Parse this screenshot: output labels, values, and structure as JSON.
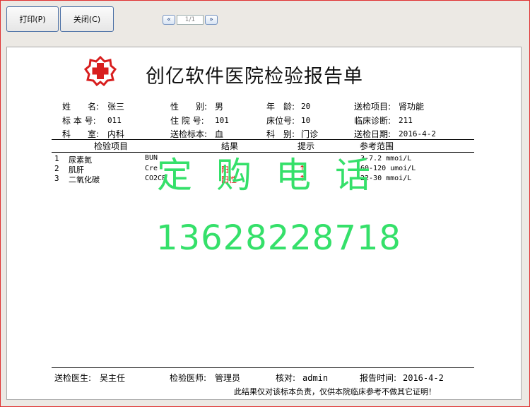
{
  "toolbar": {
    "print_label": "打印(P)",
    "close_label": "关闭(C)",
    "prev_glyph": "«",
    "next_glyph": "»",
    "page_indicator": "1/1"
  },
  "report": {
    "title": "创亿软件医院检验报告单",
    "fields": {
      "name_label": "姓　　名:",
      "name": "张三",
      "gender_label": "性　　别:",
      "gender": "男",
      "age_label": "年　龄:",
      "age": "20",
      "item_label": "送检项目:",
      "item": "肾功能",
      "specimen_no_label": "标 本 号:",
      "specimen_no": "011",
      "inpatient_no_label": "住 院 号:",
      "inpatient_no": "101",
      "bed_label": "床位号:",
      "bed": "10",
      "diagnosis_label": "临床诊断:",
      "diagnosis": "211",
      "dept_label": "科　　室:",
      "dept": "内科",
      "sample_label": "送检标本:",
      "sample": "血",
      "category_label": "科　别:",
      "category": "门诊",
      "date_label": "送检日期:",
      "date": "2016-4-2"
    },
    "table": {
      "headers": [
        "检验项目",
        "结果",
        "提示",
        "参考范围"
      ],
      "rows": [
        {
          "no": "1",
          "name": "尿素氮",
          "code": "BUN",
          "result": "",
          "flag": "",
          "range": "3-7.2 mmoi/L"
        },
        {
          "no": "2",
          "name": "肌肝",
          "code": "Cre",
          "result": "阳",
          "flag": "↑",
          "range": "60-120 umoi/L"
        },
        {
          "no": "3",
          "name": "二氧化碳",
          "code": "CO2CP",
          "result": "阳性",
          "flag": "↑",
          "range": "22-30 mmoi/L"
        }
      ]
    },
    "footer": {
      "sender_label": "送检医生:",
      "sender": "吴主任",
      "tester_label": "检验医师:",
      "tester": "管理员",
      "checker_label": "核对:",
      "checker": "admin",
      "report_time_label": "报告时间:",
      "report_time": "2016-4-2",
      "disclaimer": "此结果仅对该标本负责，仅供本院临床参考不做其它证明！"
    }
  },
  "watermark": {
    "text": "定购电话",
    "phone": "13628228718"
  },
  "colors": {
    "window_border": "#e03030",
    "watermark": "#35e06a",
    "alert": "#e00000",
    "logo": "#d81e1e"
  }
}
